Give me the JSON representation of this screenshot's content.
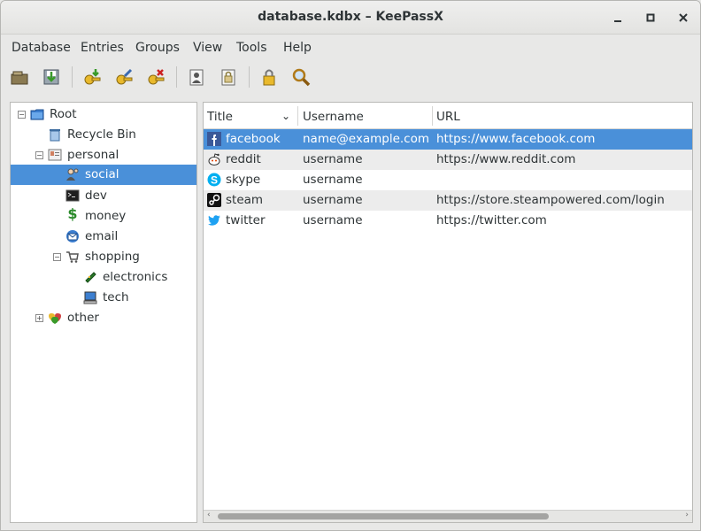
{
  "window": {
    "title": "database.kdbx – KeePassX"
  },
  "controls": {
    "minimize": "_",
    "maximize": "□",
    "close": "✕"
  },
  "menu": [
    "Database",
    "Entries",
    "Groups",
    "View",
    "Tools",
    "Help"
  ],
  "toolbar": [
    "open-database-icon",
    "save-database-icon",
    "add-entry-icon",
    "edit-entry-icon",
    "delete-entry-icon",
    "copy-username-icon",
    "copy-password-icon",
    "lock-icon",
    "search-icon"
  ],
  "tree": [
    {
      "label": "Root",
      "expander": "−",
      "icon": "folder-icon"
    },
    {
      "label": "Recycle Bin",
      "icon": "recycle-bin-icon"
    },
    {
      "label": "personal",
      "expander": "−",
      "icon": "personal-icon"
    },
    {
      "label": "social",
      "icon": "users-icon",
      "selected": true
    },
    {
      "label": "dev",
      "icon": "terminal-icon"
    },
    {
      "label": "money",
      "icon": "dollar-icon"
    },
    {
      "label": "email",
      "icon": "email-icon"
    },
    {
      "label": "shopping",
      "expander": "−",
      "icon": "cart-icon"
    },
    {
      "label": "electronics",
      "icon": "circuit-icon"
    },
    {
      "label": "tech",
      "icon": "computer-icon"
    },
    {
      "label": "other",
      "expander": "+",
      "icon": "hearts-icon"
    }
  ],
  "columns": [
    "Title",
    "Username",
    "URL"
  ],
  "sort_indicator": "⌄",
  "entries": [
    {
      "title": "facebook",
      "username": "name@example.com",
      "url": "https://www.facebook.com",
      "icon": "facebook-icon",
      "selected": true
    },
    {
      "title": "reddit",
      "username": "username",
      "url": "https://www.reddit.com",
      "icon": "reddit-icon"
    },
    {
      "title": "skype",
      "username": "username",
      "url": "",
      "icon": "skype-icon"
    },
    {
      "title": "steam",
      "username": "username",
      "url": "https://store.steampowered.com/login",
      "icon": "steam-icon"
    },
    {
      "title": "twitter",
      "username": "username",
      "url": "https://twitter.com",
      "icon": "twitter-icon"
    }
  ],
  "colors": {
    "selection": "#4a90d9",
    "alt_row": "#ececec"
  },
  "scrollbar_arrows": [
    "‹",
    "›"
  ]
}
